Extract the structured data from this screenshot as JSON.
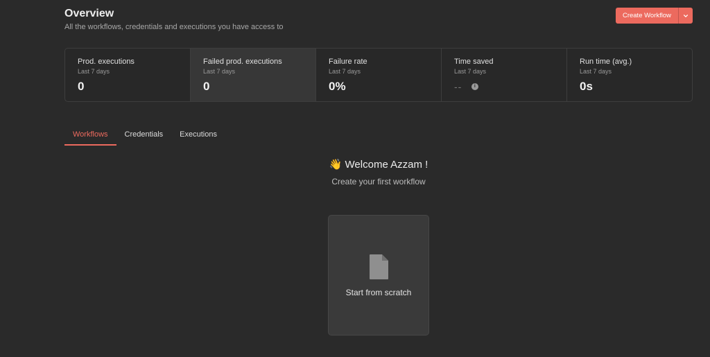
{
  "header": {
    "title": "Overview",
    "subtitle": "All the workflows, credentials and executions you have access to",
    "create_label": "Create Workflow"
  },
  "stats": [
    {
      "label": "Prod. executions",
      "period": "Last 7 days",
      "value": "0"
    },
    {
      "label": "Failed prod. executions",
      "period": "Last 7 days",
      "value": "0"
    },
    {
      "label": "Failure rate",
      "period": "Last 7 days",
      "value": "0%"
    },
    {
      "label": "Time saved",
      "period": "Last 7 days",
      "value": "--"
    },
    {
      "label": "Run time (avg.)",
      "period": "Last 7 days",
      "value": "0s"
    }
  ],
  "tabs": [
    {
      "label": "Workflows",
      "active": true
    },
    {
      "label": "Credentials",
      "active": false
    },
    {
      "label": "Executions",
      "active": false
    }
  ],
  "welcome": {
    "emoji": "👋",
    "title": "Welcome Azzam !",
    "subtitle": "Create your first workflow"
  },
  "scratch": {
    "label": "Start from scratch",
    "icon": "file-icon"
  },
  "colors": {
    "accent": "#ec6a5e",
    "background": "#2a2a2a",
    "card": "#3a3a3a"
  }
}
